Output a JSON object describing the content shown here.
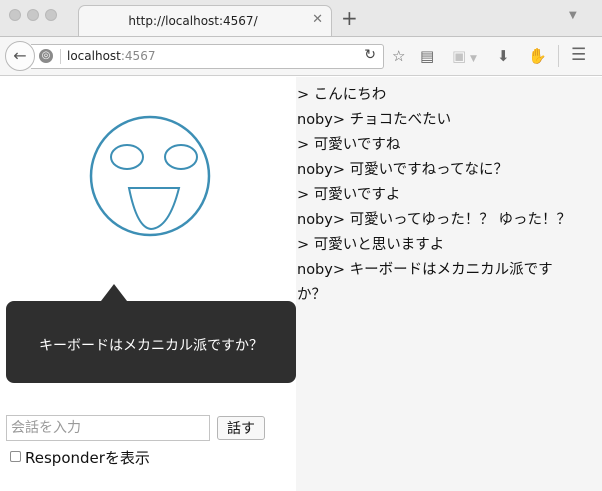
{
  "browser": {
    "tab_title": "http://localhost:4567/",
    "tab_close": "✕",
    "new_tab": "+",
    "url_host": "localhost",
    "url_port": ":4567"
  },
  "speech_bubble": "キーボードはメカニカル派ですか？",
  "input": {
    "placeholder": "会話を入力",
    "value": ""
  },
  "send_button": "話す",
  "responder_label": "Responderを表示",
  "responder_checked": false,
  "log": [
    "> こんにちわ",
    "noby> チョコたべたい",
    "> 可愛いですね",
    "noby> 可愛いですねってなに？",
    "> 可愛いですよ",
    "noby> 可愛いってゆった！？ ゆった！？",
    "> 可愛いと思いますよ",
    "noby> キーボードはメカニカル派です",
    "か？"
  ],
  "colors": {
    "face_stroke": "#3d8fb5",
    "bubble_bg": "#2f2f2f",
    "log_bg": "#f5f5f5"
  }
}
